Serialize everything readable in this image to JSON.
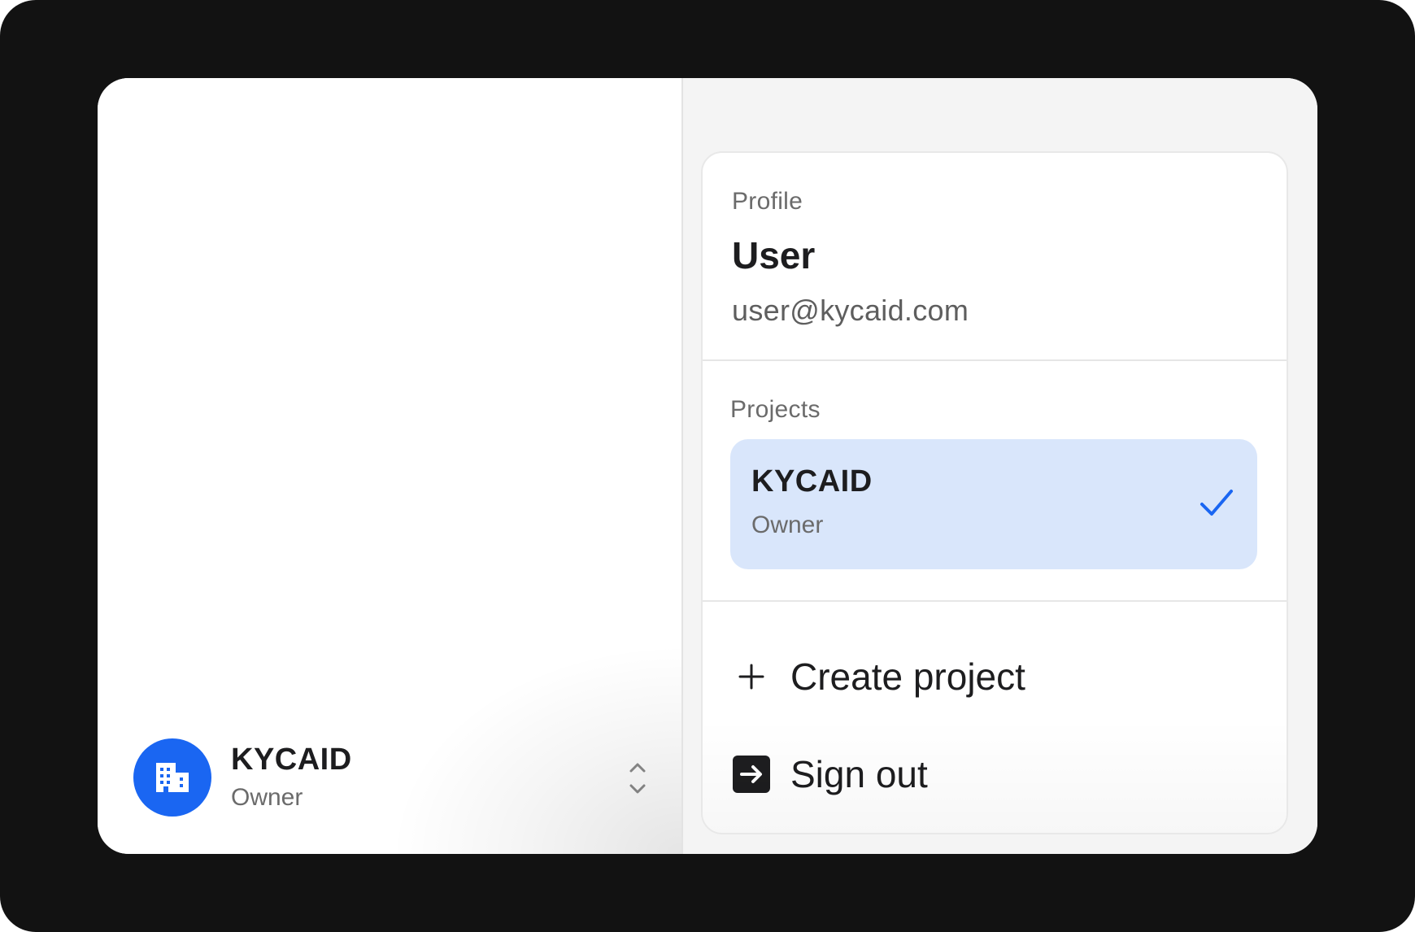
{
  "account_switcher": {
    "name": "KYCAID",
    "role": "Owner",
    "avatar_icon": "building-icon",
    "toggle_icon": "chevron-up-down-icon"
  },
  "menu": {
    "profile": {
      "label": "Profile",
      "name": "User",
      "email": "user@kycaid.com"
    },
    "projects": {
      "label": "Projects",
      "items": [
        {
          "name": "KYCAID",
          "role": "Owner",
          "selected": true
        }
      ]
    },
    "actions": {
      "create_project": "Create project",
      "sign_out": "Sign out"
    }
  },
  "colors": {
    "accent": "#1a66f2",
    "selected_background": "#d9e6fb",
    "frame": "#121212"
  }
}
